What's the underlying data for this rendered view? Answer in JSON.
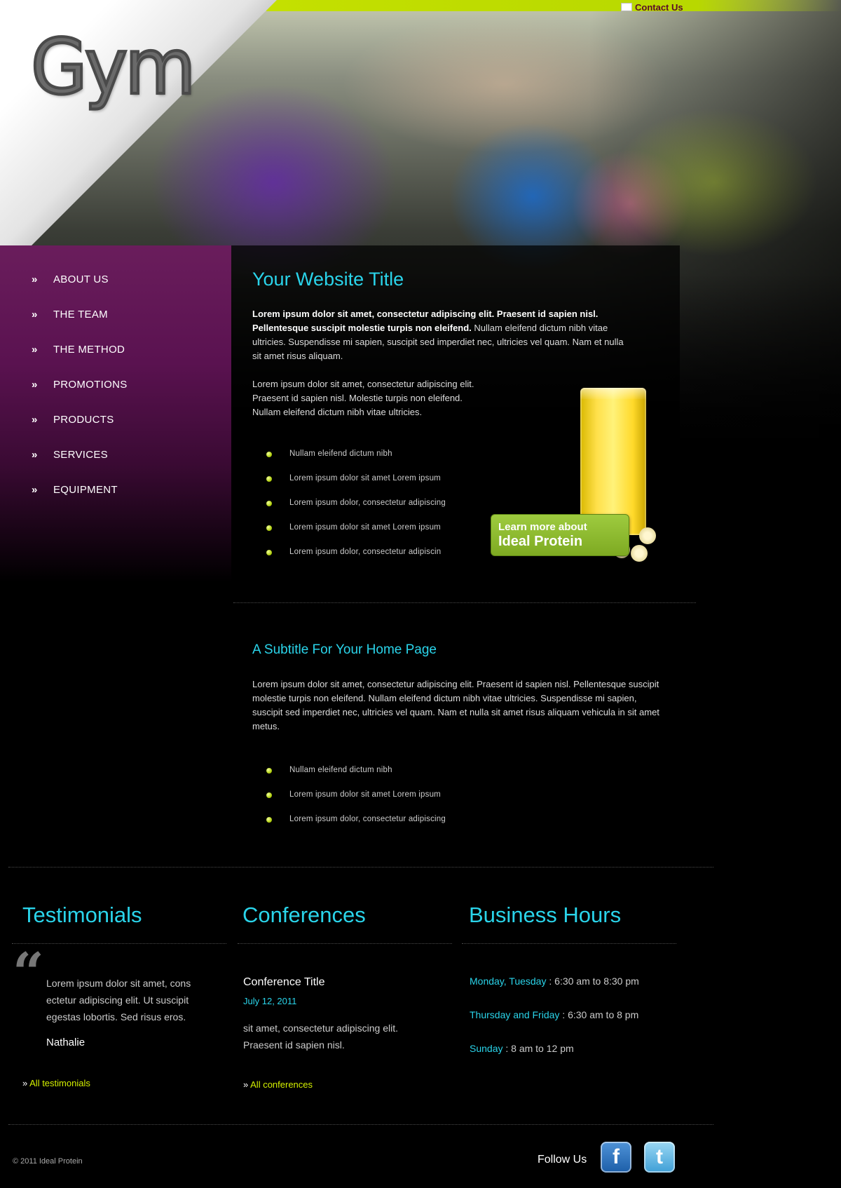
{
  "header": {
    "logo_text": "Gym",
    "contact_label": "Contact Us",
    "accent_color": "#c4e000",
    "title_color": "#2ad4ea",
    "hero_icon": "gym-class-photo"
  },
  "nav": {
    "items": [
      {
        "label": "ABOUT US"
      },
      {
        "label": "THE TEAM"
      },
      {
        "label": "THE METHOD"
      },
      {
        "label": "PROMOTIONS"
      },
      {
        "label": "PRODUCTS"
      },
      {
        "label": "SERVICES"
      },
      {
        "label": "EQUIPMENT"
      }
    ],
    "marker": "»"
  },
  "main": {
    "title": "Your Website Title",
    "intro_bold": "Lorem ipsum dolor sit amet, consectetur adipiscing elit. Praesent id sapien nisl. Pellentesque suscipit molestie turpis non eleifend.",
    "intro_rest": " Nullam eleifend dictum nibh vitae ultricies. Suspendisse mi sapien, suscipit sed imperdiet nec, ultricies vel quam. Nam et nulla sit amet risus aliquam.",
    "para2": "Lorem ipsum dolor sit amet, consectetur adipiscing elit. Praesent id sapien nisl. Molestie turpis non eleifend. Nullam eleifend dictum nibh vitae ultricies.",
    "bullets": [
      "Nullam eleifend dictum nibh",
      "Lorem ipsum dolor sit amet Lorem ipsum",
      "Lorem ipsum dolor, consectetur adipiscing",
      "Lorem ipsum dolor sit amet Lorem ipsum",
      "Lorem ipsum dolor, consectetur adipiscin"
    ],
    "promo": {
      "line1": "Learn more about",
      "line2": "Ideal Protein"
    }
  },
  "subsection": {
    "title": "A Subtitle For Your Home Page",
    "text": "Lorem ipsum dolor sit amet, consectetur adipiscing elit. Praesent id sapien nisl. Pellentesque suscipit molestie turpis non eleifend. Nullam eleifend dictum nibh vitae ultricies. Suspendisse mi sapien, suscipit sed imperdiet nec, ultricies vel quam. Nam et nulla sit amet risus aliquam vehicula in sit amet metus.",
    "bullets": [
      "Nullam eleifend dictum nibh",
      "Lorem ipsum dolor sit amet Lorem ipsum",
      "Lorem ipsum dolor, consectetur adipiscing"
    ]
  },
  "testimonials": {
    "heading": "Testimonials",
    "quote_mark": "“",
    "text": "Lorem ipsum dolor sit amet, cons ectetur adipiscing elit. Ut suscipit egestas lobortis. Sed risus eros.",
    "author": "Nathalie",
    "link_label": "All testimonials",
    "link_marker": "»"
  },
  "conferences": {
    "heading": "Conferences",
    "item_title": "Conference Title",
    "item_date": "July 12, 2011",
    "item_text": "sit amet, consectetur adipiscing elit. Praesent id sapien nisl.",
    "link_label": "All conferences",
    "link_marker": "»"
  },
  "hours": {
    "heading": "Business Hours",
    "rows": [
      {
        "days": "Monday, Tuesday",
        "time": " : 6:30 am to 8:30 pm"
      },
      {
        "days": "Thursday and Friday",
        "time": " : 6:30 am to 8 pm"
      },
      {
        "days": "Sunday",
        "time": " : 8 am to 12 pm"
      }
    ]
  },
  "footer": {
    "copyright": "© 2011 Ideal Protein",
    "follow_label": "Follow Us",
    "facebook_glyph": "f",
    "twitter_glyph": "t"
  }
}
